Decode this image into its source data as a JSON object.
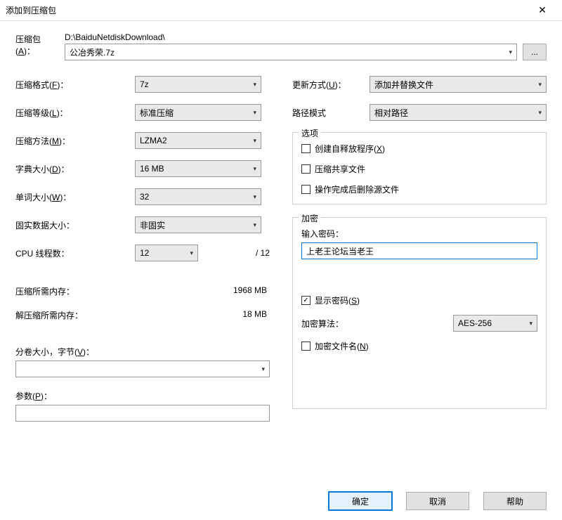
{
  "window": {
    "title": "添加到压缩包"
  },
  "archive": {
    "label": "压缩包(A)：",
    "label_html": "压缩包(<span class='underline'>A</span>)：",
    "path": "D:\\BaiduNetdiskDownload\\",
    "filename": "公冶秀荣.7z",
    "browse": "..."
  },
  "left": {
    "format": {
      "label": "压缩格式(F)：",
      "label_html": "压缩格式(<span class='underline'>F</span>)：",
      "value": "7z"
    },
    "level": {
      "label": "压缩等级(L)：",
      "label_html": "压缩等级(<span class='underline'>L</span>)：",
      "value": "标准压缩"
    },
    "method": {
      "label": "压缩方法(M)：",
      "label_html": "压缩方法(<span class='underline'>M</span>)：",
      "value": "LZMA2"
    },
    "dict": {
      "label": "字典大小(D)：",
      "label_html": "字典大小(<span class='underline'>D</span>)：",
      "value": "16 MB"
    },
    "word": {
      "label": "单词大小(W)：",
      "label_html": "单词大小(<span class='underline'>W</span>)：",
      "value": "32"
    },
    "solid": {
      "label": "固实数据大小：",
      "value": "非固实"
    },
    "cpu": {
      "label": "CPU 线程数：",
      "value": "12",
      "total": "/ 12"
    },
    "mem_comp": {
      "label": "压缩所需内存：",
      "value": "1968 MB"
    },
    "mem_decomp": {
      "label": "解压缩所需内存：",
      "value": "18 MB"
    },
    "volume": {
      "label": "分卷大小，字节(V)：",
      "label_html": "分卷大小，字节(<span class='underline'>V</span>)："
    },
    "params": {
      "label": "参数(P)：",
      "label_html": "参数(<span class='underline'>P</span>)："
    }
  },
  "right": {
    "update": {
      "label": "更新方式(U)：",
      "label_html": "更新方式(<span class='underline'>U</span>)：",
      "value": "添加并替换文件"
    },
    "pathmode": {
      "label": "路径模式",
      "value": "相对路径"
    },
    "options": {
      "title": "选项",
      "sfx": "创建自释放程序(X)",
      "sfx_html": "创建自释放程序(<span class='underline'>X</span>)",
      "share": "压缩共享文件",
      "delete": "操作完成后删除源文件"
    },
    "encrypt": {
      "title": "加密",
      "pwd_label": "输入密码：",
      "password": "上老王论坛当老王",
      "show_pwd": "显示密码(S)",
      "show_pwd_html": "显示密码(<span class='underline'>S</span>)",
      "show_pwd_checked": true,
      "algo_label": "加密算法：",
      "algo": "AES-256",
      "enc_names": "加密文件名(N)",
      "enc_names_html": "加密文件名(<span class='underline'>N</span>)"
    }
  },
  "buttons": {
    "ok": "确定",
    "cancel": "取消",
    "help": "帮助"
  }
}
